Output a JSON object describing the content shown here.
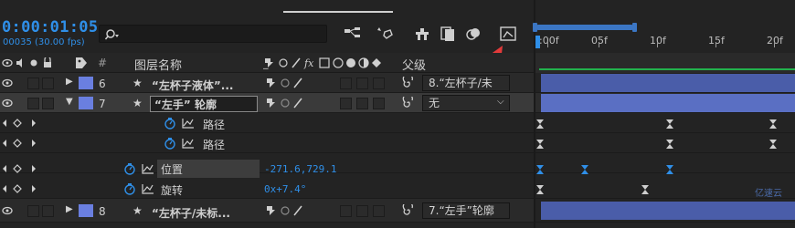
{
  "timecode": "0:00:01:05",
  "frame_info": "00035 (30.00 fps)",
  "search": {
    "placeholder": ""
  },
  "columns": {
    "layer_name": "图层名称",
    "parent": "父级",
    "number": "#"
  },
  "ruler": {
    "labels": [
      ":00f",
      "05f",
      "10f",
      "15f",
      "20f"
    ]
  },
  "rows": [
    {
      "number": "6",
      "name": "“左杯子液体”...",
      "parent": "8.“左杯子/未"
    },
    {
      "number": "7",
      "name": "“左手” 轮廓",
      "parent": "无"
    },
    {
      "name": "路径"
    },
    {
      "name": "路径"
    },
    {
      "name": "位置",
      "value": "-271.6,729.1"
    },
    {
      "name": "旋转",
      "value": "0x+7.4°"
    },
    {
      "number": "8",
      "name": "“左杯子/未标...",
      "parent": "7.“左手”轮廓"
    }
  ],
  "watermark": "亿速云",
  "colors": {
    "accent": "#2f8fe8",
    "layer_label": "#6a7fe0",
    "bar": "#4a5da9",
    "annotation_arrow": "#e23a3a",
    "work_area_green": "#22b14c"
  }
}
